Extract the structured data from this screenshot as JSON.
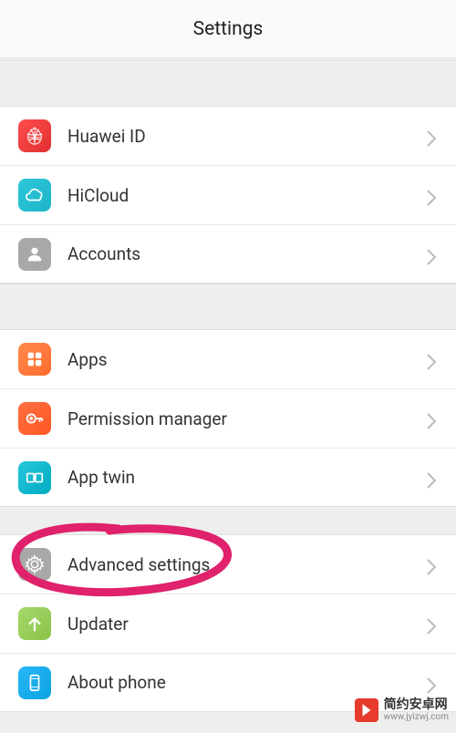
{
  "header": {
    "title": "Settings"
  },
  "groups": [
    {
      "items": [
        {
          "id": "huawei-id",
          "label": "Huawei ID",
          "icon": "huawei"
        },
        {
          "id": "hicloud",
          "label": "HiCloud",
          "icon": "cloud"
        },
        {
          "id": "accounts",
          "label": "Accounts",
          "icon": "person"
        }
      ]
    },
    {
      "items": [
        {
          "id": "apps",
          "label": "Apps",
          "icon": "grid"
        },
        {
          "id": "permission",
          "label": "Permission manager",
          "icon": "key"
        },
        {
          "id": "apptwin",
          "label": "App twin",
          "icon": "twin"
        }
      ]
    },
    {
      "items": [
        {
          "id": "advanced",
          "label": "Advanced settings",
          "icon": "gear",
          "highlighted": true
        },
        {
          "id": "updater",
          "label": "Updater",
          "icon": "arrow-up"
        },
        {
          "id": "about",
          "label": "About phone",
          "icon": "phone"
        }
      ]
    }
  ],
  "watermark": {
    "cn": "简约安卓网",
    "url": "www.jyizwj.com"
  }
}
